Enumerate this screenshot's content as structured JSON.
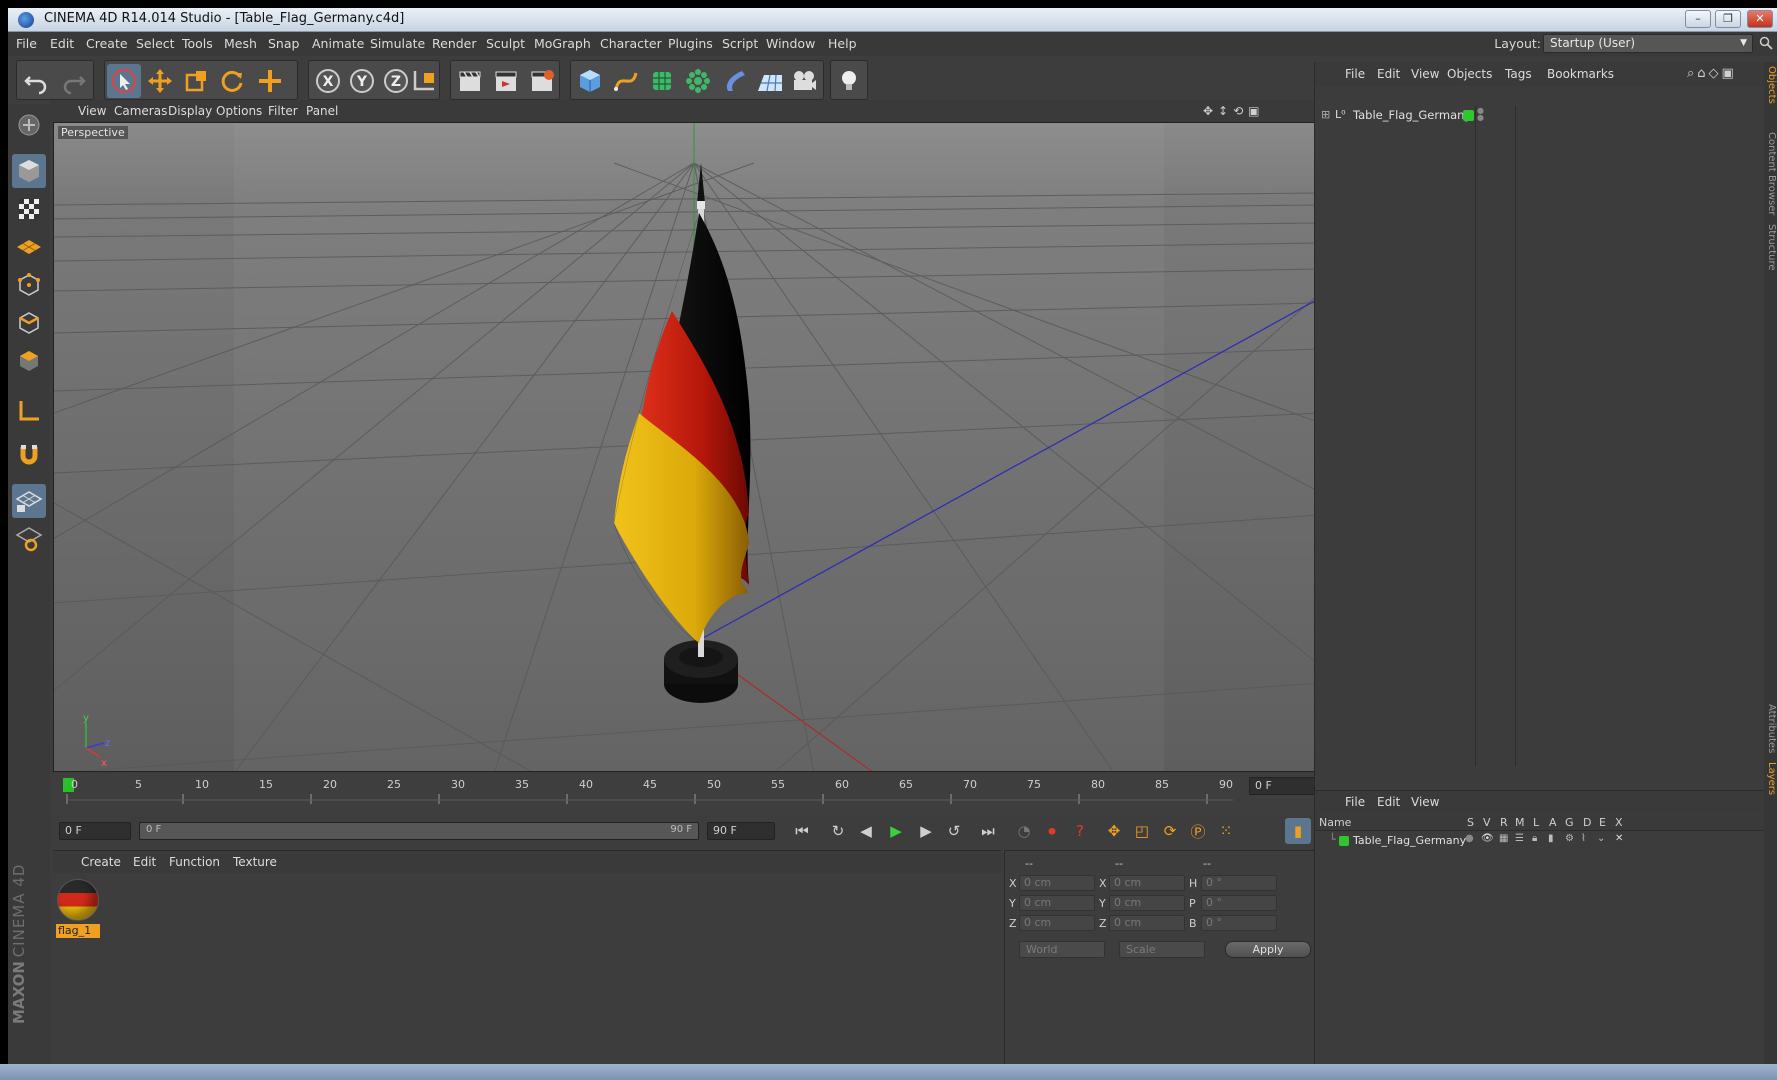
{
  "window": {
    "title": "CINEMA 4D R14.014 Studio - [Table_Flag_Germany.c4d]",
    "minimize": "–",
    "maximize": "❐",
    "close": "✕"
  },
  "menubar": {
    "items": [
      "File",
      "Edit",
      "Create",
      "Select",
      "Tools",
      "Mesh",
      "Snap",
      "Animate",
      "Simulate",
      "Render",
      "Sculpt",
      "MoGraph",
      "Character",
      "Plugins",
      "Script",
      "Window",
      "Help"
    ],
    "layout_label": "Layout:",
    "layout_value": "Startup (User)"
  },
  "viewport": {
    "menu": [
      "View",
      "Cameras",
      "Display",
      "Options",
      "Filter",
      "Panel"
    ],
    "camera_label": "Perspective",
    "axis_x": "x",
    "axis_y": "y",
    "axis_z": "z"
  },
  "timeline": {
    "ticks": [
      "0",
      "5",
      "10",
      "15",
      "20",
      "25",
      "30",
      "35",
      "40",
      "45",
      "50",
      "55",
      "60",
      "65",
      "70",
      "75",
      "80",
      "85",
      "90"
    ],
    "current_frame_field": "0 F",
    "start_field": "0 F",
    "slider_start": "0 F",
    "slider_end": "90 F",
    "end_field": "90 F"
  },
  "material_manager": {
    "menu": [
      "Create",
      "Edit",
      "Function",
      "Texture"
    ],
    "materials": [
      {
        "name": "flag_1"
      }
    ]
  },
  "coordinates": {
    "headers": [
      "--",
      "--",
      "--"
    ],
    "rows": [
      {
        "l1": "X",
        "v1": "0 cm",
        "l2": "X",
        "v2": "0 cm",
        "l3": "H",
        "v3": "0 °"
      },
      {
        "l1": "Y",
        "v1": "0 cm",
        "l2": "Y",
        "v2": "0 cm",
        "l3": "P",
        "v3": "0 °"
      },
      {
        "l1": "Z",
        "v1": "0 cm",
        "l2": "Z",
        "v2": "0 cm",
        "l3": "B",
        "v3": "0 °"
      }
    ],
    "space_dropdown": "World",
    "mode_dropdown": "Scale",
    "apply_label": "Apply"
  },
  "object_manager": {
    "menu": [
      "File",
      "Edit",
      "View",
      "Objects",
      "Tags",
      "Bookmarks"
    ],
    "objects": [
      {
        "name": "Table_Flag_Germany"
      }
    ]
  },
  "layer_manager": {
    "menu": [
      "File",
      "Edit",
      "View"
    ],
    "columns": [
      "Name",
      "S",
      "V",
      "R",
      "M",
      "L",
      "A",
      "G",
      "D",
      "E",
      "X"
    ],
    "rows": [
      {
        "name": "Table_Flag_Germany"
      }
    ]
  },
  "right_tabs": [
    "Objects",
    "Content Browser",
    "Structure",
    "Attributes",
    "Layers"
  ],
  "branding": {
    "maxon": "MAXON",
    "product": "CINEMA 4D"
  },
  "colors": {
    "accent": "#e8a020",
    "flag_black": "#111111",
    "flag_red": "#c8200f",
    "flag_gold": "#e6b00a",
    "layer_green": "#2ec82e"
  }
}
